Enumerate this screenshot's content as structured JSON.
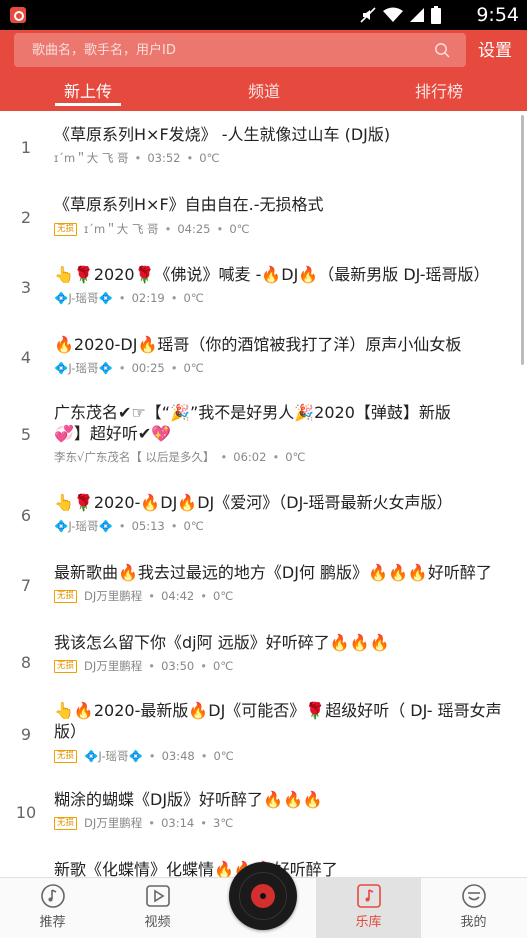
{
  "status_bar": {
    "time": "9:54"
  },
  "search": {
    "placeholder": "歌曲名，歌手名，用户ID"
  },
  "header": {
    "settings_label": "设置"
  },
  "tabs": [
    {
      "label": "新上传",
      "active": true
    },
    {
      "label": "频道",
      "active": false
    },
    {
      "label": "排行榜",
      "active": false
    }
  ],
  "songs": [
    {
      "rank": "1",
      "title": "《草原系列H×F发烧》 -人生就像过山车 (DJ版)",
      "badge": "",
      "uploader": "ɪ´m＂大  飞  哥",
      "duration": "03:52",
      "plays": "0℃"
    },
    {
      "rank": "2",
      "title": "《草原系列H×F》自由自在.-无损格式",
      "badge": "无损",
      "uploader": "ɪ´m＂大  飞  哥",
      "duration": "04:25",
      "plays": "0℃"
    },
    {
      "rank": "3",
      "title": "👆🌹2020🌹《佛说》喊麦 -🔥DJ🔥（最新男版 DJ-瑶哥版）",
      "badge": "",
      "uploader": "💠J-瑶哥💠",
      "duration": "02:19",
      "plays": "0℃"
    },
    {
      "rank": "4",
      "title": "🔥2020-DJ🔥瑶哥（你的酒馆被我打了洋）原声小仙女板",
      "badge": "",
      "uploader": "💠J-瑶哥💠",
      "duration": "00:25",
      "plays": "0℃"
    },
    {
      "rank": "5",
      "title": "广东茂名✔☞【“🎉”我不是好男人🎉2020【弹鼓】新版💞】超好听✔💖",
      "badge": "",
      "uploader": "李东√广东茂名【 以后是多久】",
      "duration": "06:02",
      "plays": "0℃"
    },
    {
      "rank": "6",
      "title": "👆🌹2020-🔥DJ🔥DJ《爱河》（DJ-瑶哥最新火女声版）",
      "badge": "",
      "uploader": "💠J-瑶哥💠",
      "duration": "05:13",
      "plays": "0℃"
    },
    {
      "rank": "7",
      "title": "最新歌曲🔥我去过最远的地方《DJ何 鹏版》🔥🔥🔥好听醉了",
      "badge": "无损",
      "uploader": "DJ万里鹏程",
      "duration": "04:42",
      "plays": "0℃"
    },
    {
      "rank": "8",
      "title": "我该怎么留下你《dj阿 远版》好听碎了🔥🔥🔥",
      "badge": "无损",
      "uploader": "DJ万里鹏程",
      "duration": "03:50",
      "plays": "0℃"
    },
    {
      "rank": "9",
      "title": "👆🔥2020-最新版🔥DJ《可能否》🌹超级好听（ DJ- 瑶哥女声版）",
      "badge": "无损",
      "uploader": "💠J-瑶哥💠",
      "duration": "03:48",
      "plays": "0℃"
    },
    {
      "rank": "10",
      "title": "糊涂的蝴蝶《DJ版》好听醉了🔥🔥🔥",
      "badge": "无损",
      "uploader": "DJ万里鹏程",
      "duration": "03:14",
      "plays": "3℃"
    },
    {
      "rank": "11",
      "title": "新歌《化蝶情》化蝶情🔥🔥🔥好听醉了",
      "badge": "",
      "uploader": "",
      "duration": "",
      "plays": ""
    }
  ],
  "nav": [
    {
      "label": "推荐",
      "icon": "music-note-icon",
      "active": false
    },
    {
      "label": "视频",
      "icon": "video-play-icon",
      "active": false
    },
    {
      "label": "乐库",
      "icon": "music-library-icon",
      "active": true
    },
    {
      "label": "我的",
      "icon": "profile-face-icon",
      "active": false
    }
  ],
  "colors": {
    "accent": "#e64a3f",
    "badge": "#f0a000"
  }
}
